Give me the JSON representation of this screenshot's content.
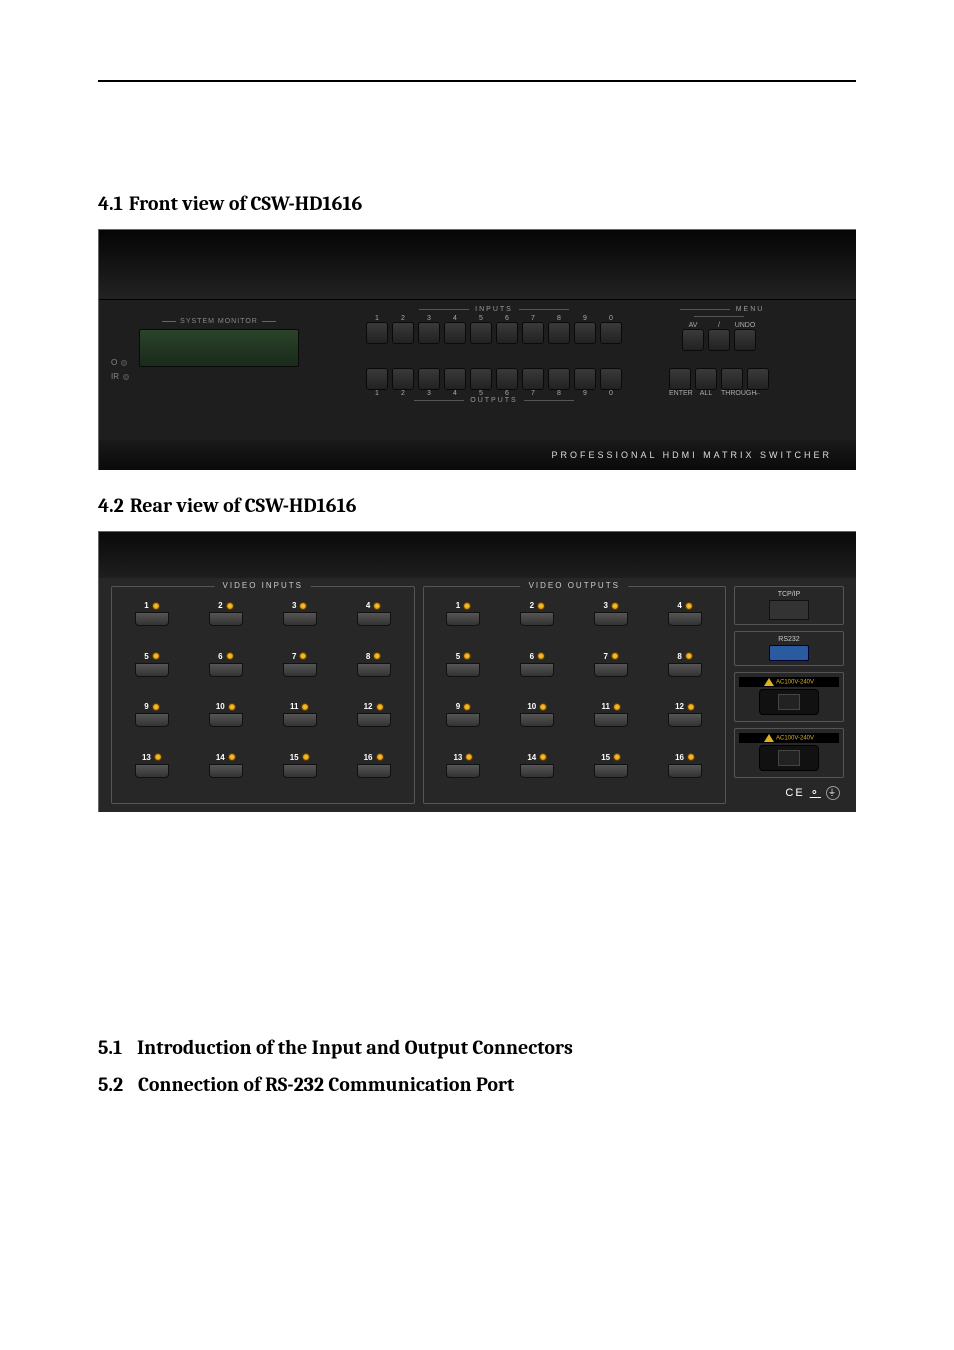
{
  "sections": {
    "s41": {
      "num": "4.1",
      "title": "Front view of CSW-HD1616"
    },
    "s42": {
      "num": "4.2",
      "title": "Rear view of CSW-HD1616"
    },
    "s51": {
      "num": "5.1",
      "title": "Introduction of the Input and Output Connectors"
    },
    "s52": {
      "num": "5.2",
      "title": "Connection of RS-232 Communication Port"
    }
  },
  "front": {
    "system_monitor_label": "SYSTEM MONITOR",
    "o_label": "O",
    "ir_label": "IR",
    "inputs_label": "INPUTS",
    "outputs_label": "OUTPUTS",
    "menu_label": "MENU",
    "input_nums": [
      "1",
      "2",
      "3",
      "4",
      "5",
      "6",
      "7",
      "8",
      "9",
      "0"
    ],
    "output_nums": [
      "1",
      "2",
      "3",
      "4",
      "5",
      "6",
      "7",
      "8",
      "9",
      "0"
    ],
    "menu_top": [
      "AV",
      "/",
      "UNDO"
    ],
    "menu_bottom": [
      "ENTER",
      "ALL",
      "THROUGH",
      "←"
    ],
    "footer": "PROFESSIONAL HDMI MATRIX SWITCHER"
  },
  "rear": {
    "video_inputs_label": "VIDEO INPUTS",
    "video_outputs_label": "VIDEO OUTPUTS",
    "input_ports": [
      "1",
      "2",
      "3",
      "4",
      "5",
      "6",
      "7",
      "8",
      "9",
      "10",
      "11",
      "12",
      "13",
      "14",
      "15",
      "16"
    ],
    "output_ports": [
      "1",
      "2",
      "3",
      "4",
      "5",
      "6",
      "7",
      "8",
      "9",
      "10",
      "11",
      "12",
      "13",
      "14",
      "15",
      "16"
    ],
    "tcpip_label": "TCP/IP",
    "rs232_label": "RS232",
    "ac_label": "AC100V-240V",
    "ce_text": "CE",
    "ground_symbol": "⏚"
  }
}
